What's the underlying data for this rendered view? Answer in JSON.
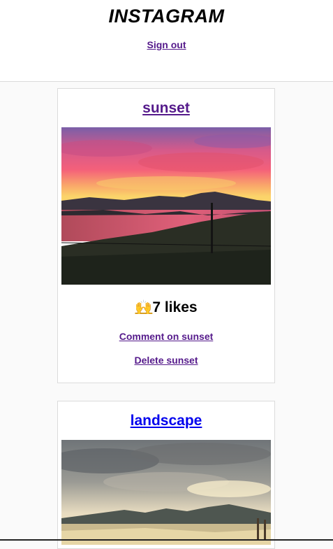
{
  "header": {
    "logo": "INSTAGRAM",
    "sign_out_label": "Sign out"
  },
  "posts": [
    {
      "title": "sunset",
      "likes_emoji": "🙌",
      "likes_text": "7 likes",
      "comment_label": "Comment on sunset",
      "delete_label": "Delete sunset"
    },
    {
      "title": "landscape"
    }
  ]
}
